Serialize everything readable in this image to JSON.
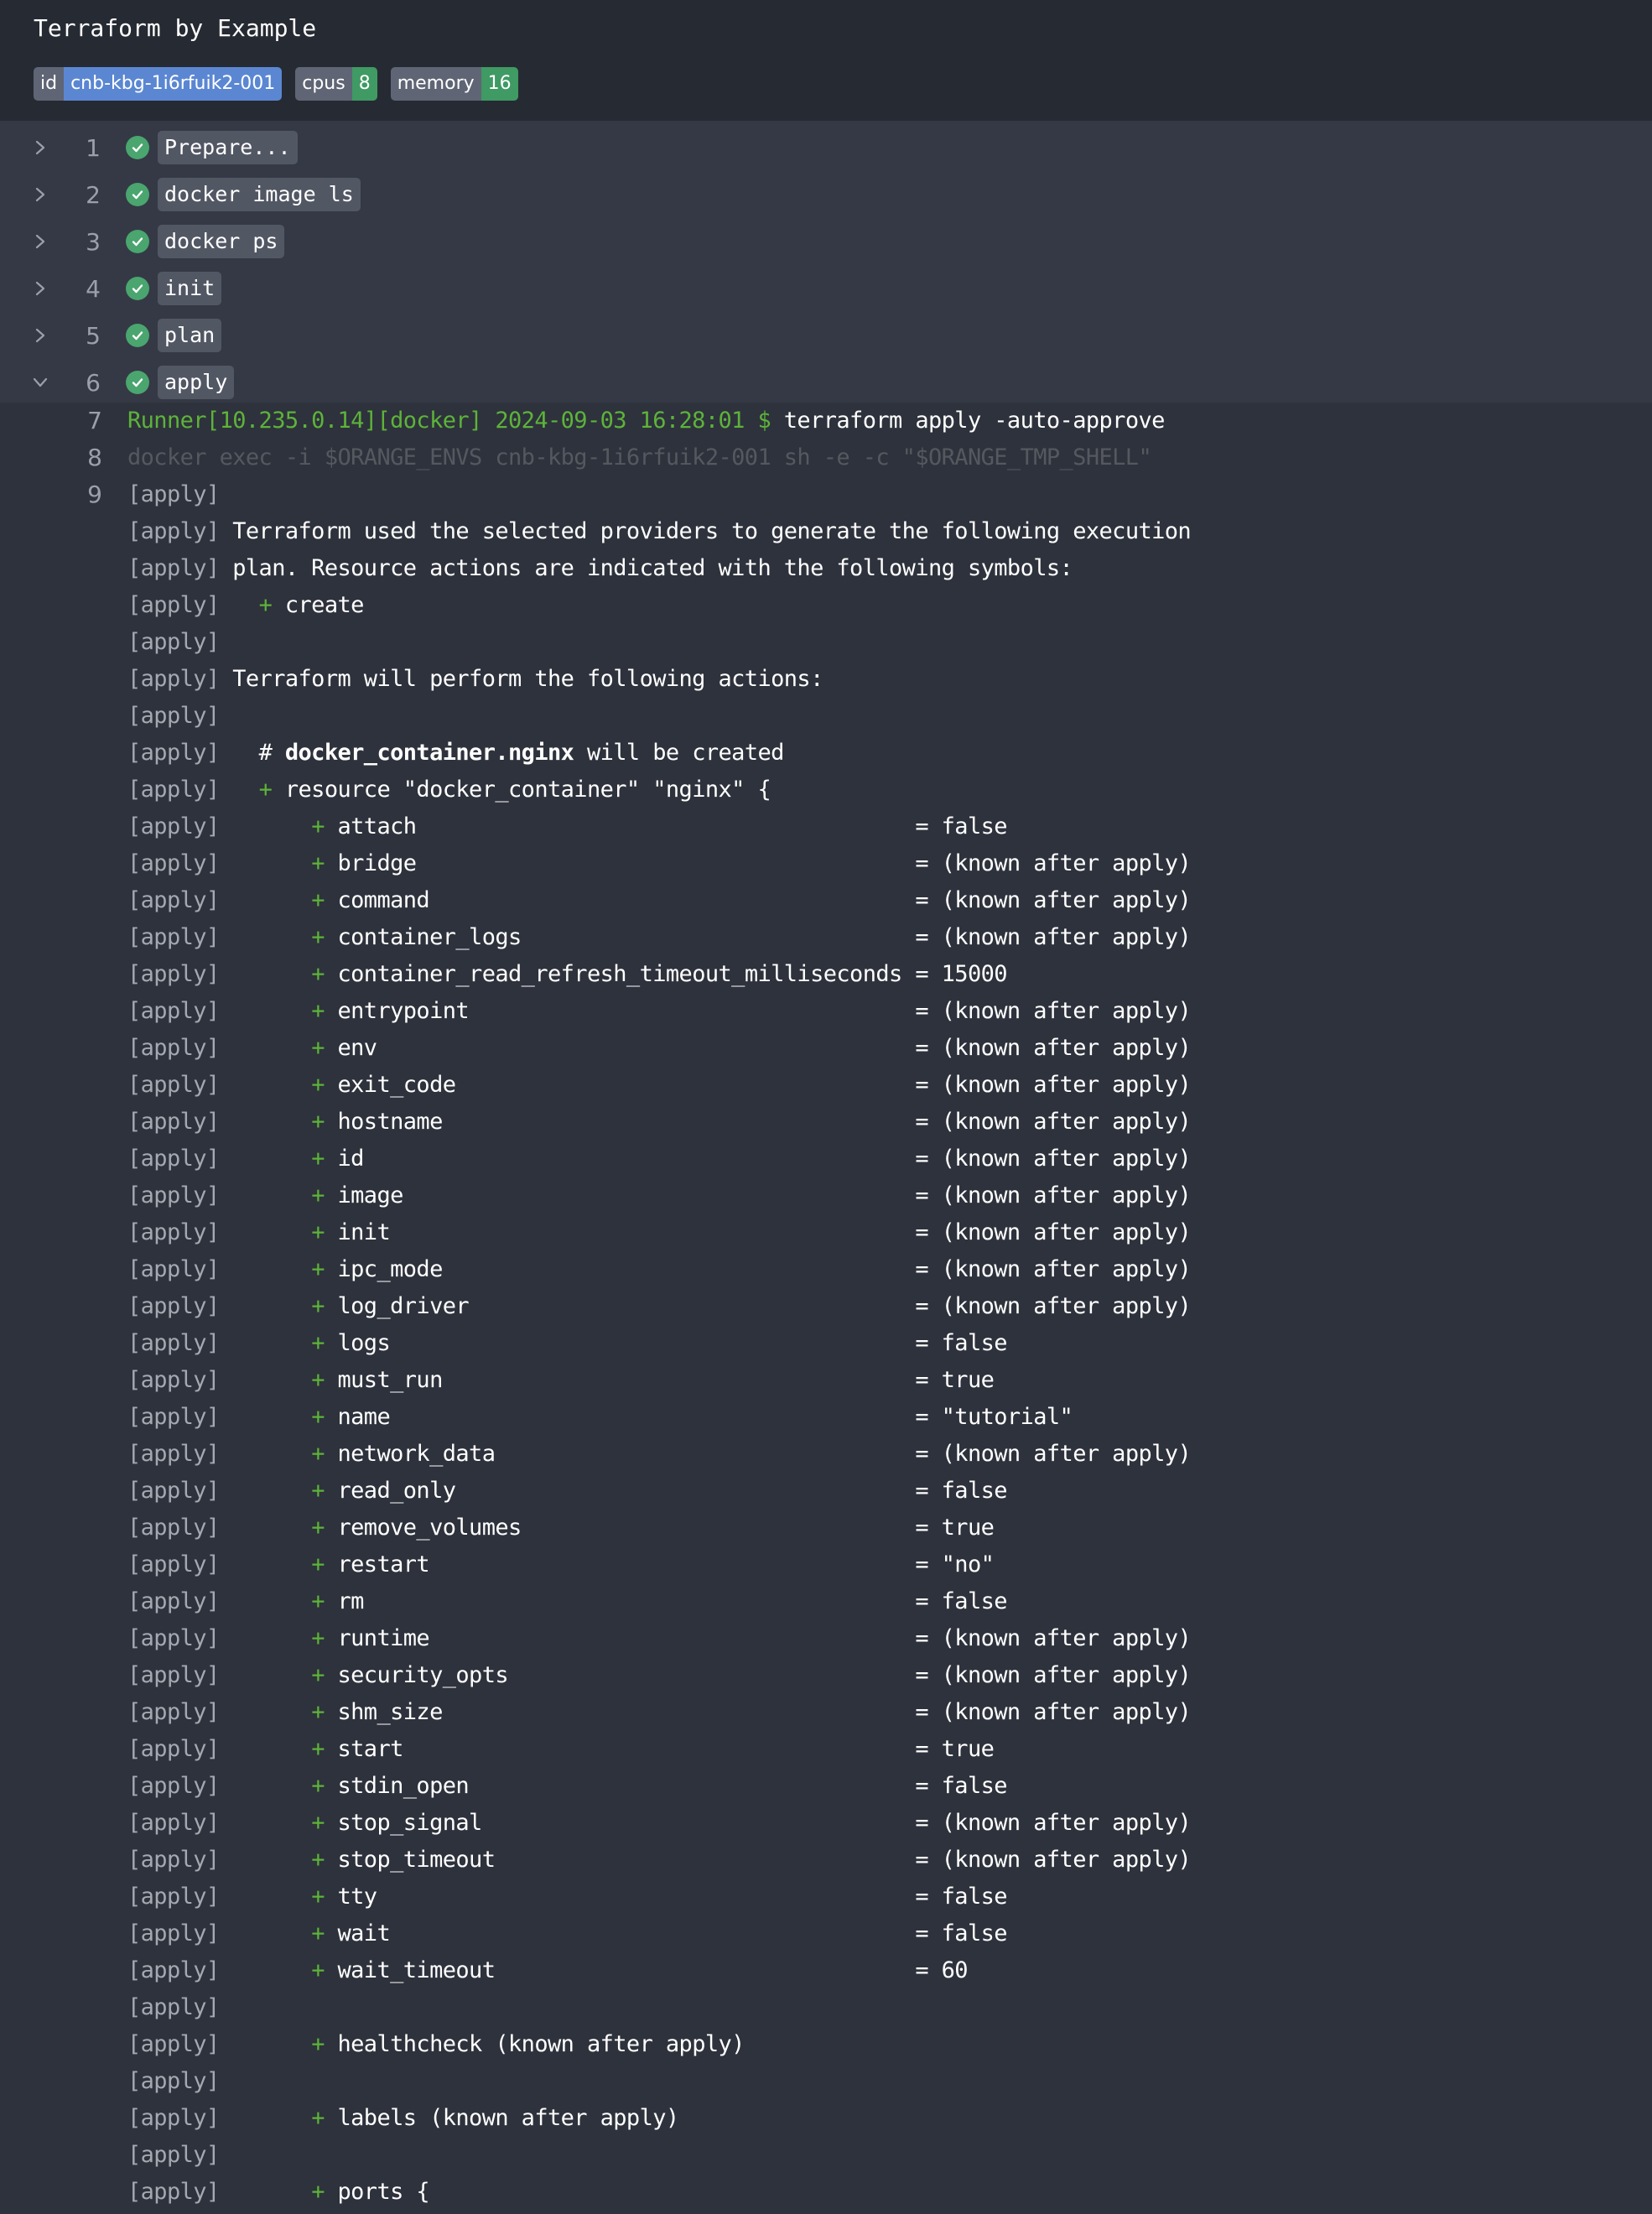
{
  "header": {
    "title": "Terraform by Example",
    "badges": [
      {
        "key": "id",
        "value": "cnb-kbg-1i6rfuik2-001",
        "color": "#5b87d2"
      },
      {
        "key": "cpus",
        "value": "8",
        "color": "#3f9a63"
      },
      {
        "key": "memory",
        "value": "16",
        "color": "#3f9a63"
      }
    ]
  },
  "steps": [
    {
      "number": "1",
      "label": "Prepare...",
      "status": "success",
      "expanded": false
    },
    {
      "number": "2",
      "label": "docker image ls",
      "status": "success",
      "expanded": false
    },
    {
      "number": "3",
      "label": "docker ps",
      "status": "success",
      "expanded": false
    },
    {
      "number": "4",
      "label": "init",
      "status": "success",
      "expanded": false
    },
    {
      "number": "5",
      "label": "plan",
      "status": "success",
      "expanded": false
    },
    {
      "number": "6",
      "label": "apply",
      "status": "success",
      "expanded": true
    }
  ],
  "log": {
    "runner_line": {
      "number": "7",
      "prompt": "Runner[10.235.0.14][docker] 2024-09-03 16:28:01 $ ",
      "command": "terraform apply -auto-approve"
    },
    "exec_line": {
      "number": "8",
      "text": "docker exec -i $ORANGE_ENVS cnb-kbg-1i6rfuik2-001 sh -e -c \"$ORANGE_TMP_SHELL\""
    },
    "first_output_number": "9",
    "prefix": "[apply]",
    "lines": [
      {
        "plus": false,
        "text": ""
      },
      {
        "plus": false,
        "text": " Terraform used the selected providers to generate the following execution"
      },
      {
        "plus": false,
        "text": " plan. Resource actions are indicated with the following symbols:"
      },
      {
        "indent": "   ",
        "plus": true,
        "text": " create"
      },
      {
        "plus": false,
        "text": ""
      },
      {
        "plus": false,
        "text": " Terraform will perform the following actions:"
      },
      {
        "plus": false,
        "text": ""
      },
      {
        "indent": "   ",
        "plus": false,
        "hash": "# ",
        "bold": "docker_container.nginx",
        "text": " will be created"
      },
      {
        "indent": "   ",
        "plus": true,
        "text": " resource \"docker_container\" \"nginx\" {"
      },
      {
        "indent": "       ",
        "plus": true,
        "text": " attach                                      = false"
      },
      {
        "indent": "       ",
        "plus": true,
        "text": " bridge                                      = (known after apply)"
      },
      {
        "indent": "       ",
        "plus": true,
        "text": " command                                     = (known after apply)"
      },
      {
        "indent": "       ",
        "plus": true,
        "text": " container_logs                              = (known after apply)"
      },
      {
        "indent": "       ",
        "plus": true,
        "text": " container_read_refresh_timeout_milliseconds = 15000"
      },
      {
        "indent": "       ",
        "plus": true,
        "text": " entrypoint                                  = (known after apply)"
      },
      {
        "indent": "       ",
        "plus": true,
        "text": " env                                         = (known after apply)"
      },
      {
        "indent": "       ",
        "plus": true,
        "text": " exit_code                                   = (known after apply)"
      },
      {
        "indent": "       ",
        "plus": true,
        "text": " hostname                                    = (known after apply)"
      },
      {
        "indent": "       ",
        "plus": true,
        "text": " id                                          = (known after apply)"
      },
      {
        "indent": "       ",
        "plus": true,
        "text": " image                                       = (known after apply)"
      },
      {
        "indent": "       ",
        "plus": true,
        "text": " init                                        = (known after apply)"
      },
      {
        "indent": "       ",
        "plus": true,
        "text": " ipc_mode                                    = (known after apply)"
      },
      {
        "indent": "       ",
        "plus": true,
        "text": " log_driver                                  = (known after apply)"
      },
      {
        "indent": "       ",
        "plus": true,
        "text": " logs                                        = false"
      },
      {
        "indent": "       ",
        "plus": true,
        "text": " must_run                                    = true"
      },
      {
        "indent": "       ",
        "plus": true,
        "text": " name                                        = \"tutorial\""
      },
      {
        "indent": "       ",
        "plus": true,
        "text": " network_data                                = (known after apply)"
      },
      {
        "indent": "       ",
        "plus": true,
        "text": " read_only                                   = false"
      },
      {
        "indent": "       ",
        "plus": true,
        "text": " remove_volumes                              = true"
      },
      {
        "indent": "       ",
        "plus": true,
        "text": " restart                                     = \"no\""
      },
      {
        "indent": "       ",
        "plus": true,
        "text": " rm                                          = false"
      },
      {
        "indent": "       ",
        "plus": true,
        "text": " runtime                                     = (known after apply)"
      },
      {
        "indent": "       ",
        "plus": true,
        "text": " security_opts                               = (known after apply)"
      },
      {
        "indent": "       ",
        "plus": true,
        "text": " shm_size                                    = (known after apply)"
      },
      {
        "indent": "       ",
        "plus": true,
        "text": " start                                       = true"
      },
      {
        "indent": "       ",
        "plus": true,
        "text": " stdin_open                                  = false"
      },
      {
        "indent": "       ",
        "plus": true,
        "text": " stop_signal                                 = (known after apply)"
      },
      {
        "indent": "       ",
        "plus": true,
        "text": " stop_timeout                                = (known after apply)"
      },
      {
        "indent": "       ",
        "plus": true,
        "text": " tty                                         = false"
      },
      {
        "indent": "       ",
        "plus": true,
        "text": " wait                                        = false"
      },
      {
        "indent": "       ",
        "plus": true,
        "text": " wait_timeout                                = 60"
      },
      {
        "plus": false,
        "text": ""
      },
      {
        "indent": "       ",
        "plus": true,
        "text": " healthcheck (known after apply)"
      },
      {
        "plus": false,
        "text": ""
      },
      {
        "indent": "       ",
        "plus": true,
        "text": " labels (known after apply)"
      },
      {
        "plus": false,
        "text": ""
      },
      {
        "indent": "       ",
        "plus": true,
        "text": " ports {"
      }
    ]
  }
}
